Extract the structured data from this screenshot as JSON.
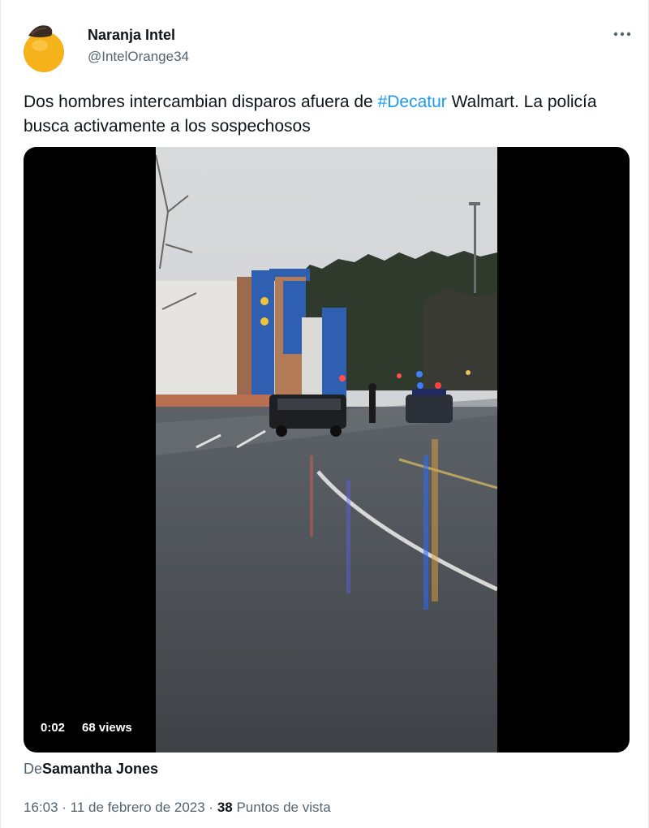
{
  "author": {
    "name": "Naranja Intel",
    "handle": "@IntelOrange34",
    "avatar_icon": "orange-fruit-avatar"
  },
  "more_icon": "more-horizontal-icon",
  "tweet": {
    "text_before": "Dos hombres intercambian disparos afuera de ",
    "hashtag": "#Decatur",
    "text_after": " Walmart. La policía busca activamente a los sospechosos"
  },
  "video": {
    "time": "0:02",
    "views": "68 views"
  },
  "credit": {
    "prefix": "De",
    "name": "Samantha Jones"
  },
  "meta": {
    "time": "16:03",
    "separator1": " · ",
    "date": "11 de febrero de 2023",
    "separator2": " · ",
    "views_count": "38",
    "views_label": " Puntos de vista"
  },
  "colors": {
    "link": "#1d9bf0",
    "secondary_text": "#536471",
    "avatar_orange": "#f6b21b"
  }
}
